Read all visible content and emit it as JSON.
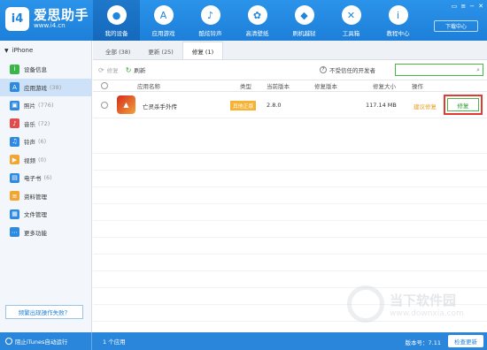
{
  "brand": {
    "name": "爱思助手",
    "url": "www.i4.cn",
    "badge": "i4"
  },
  "nav": [
    {
      "label": "我的设备",
      "icon": "apple-icon",
      "glyph": "",
      "active": true
    },
    {
      "label": "应用游戏",
      "icon": "app-store-icon",
      "glyph": "A"
    },
    {
      "label": "酷炫铃声",
      "icon": "bell-icon",
      "glyph": "♪"
    },
    {
      "label": "高清壁纸",
      "icon": "wallpaper-icon",
      "glyph": "✿"
    },
    {
      "label": "刷机越狱",
      "icon": "box-icon",
      "glyph": "◆"
    },
    {
      "label": "工具箱",
      "icon": "tools-icon",
      "glyph": "✕"
    },
    {
      "label": "教程中心",
      "icon": "info-icon",
      "glyph": "i"
    }
  ],
  "download_center": "下载中心",
  "sidebar": {
    "device": "iPhone",
    "items": [
      {
        "label": "设备信息",
        "count": "",
        "icon": "device-info-icon",
        "color": "#3bb54a"
      },
      {
        "label": "应用游戏",
        "count": "(38)",
        "icon": "apps-icon",
        "color": "#2d8ae0"
      },
      {
        "label": "照片",
        "count": "(776)",
        "icon": "photos-icon",
        "color": "#2d8ae0"
      },
      {
        "label": "音乐",
        "count": "(72)",
        "icon": "music-icon",
        "color": "#e24b4b"
      },
      {
        "label": "铃声",
        "count": "(6)",
        "icon": "ringtone-icon",
        "color": "#2d8ae0"
      },
      {
        "label": "视频",
        "count": "(0)",
        "icon": "video-icon",
        "color": "#f2a531"
      },
      {
        "label": "电子书",
        "count": "(6)",
        "icon": "ebook-icon",
        "color": "#2d8ae0"
      },
      {
        "label": "资料管理",
        "count": "",
        "icon": "data-manage-icon",
        "color": "#f2a531"
      },
      {
        "label": "文件管理",
        "count": "",
        "icon": "file-manage-icon",
        "color": "#2d8ae0"
      },
      {
        "label": "更多功能",
        "count": "",
        "icon": "more-icon",
        "color": "#2d8ae0"
      }
    ],
    "feedback": "频繁出现操作失败？"
  },
  "tabs": [
    {
      "label": "全部 (38)"
    },
    {
      "label": "更新 (25)"
    },
    {
      "label": "修复 (1)",
      "active": true
    }
  ],
  "toolbar": {
    "repair": "修复",
    "refresh": "刷新",
    "untrusted": "不受信任的开发者"
  },
  "table": {
    "headers": {
      "name": "应用名称",
      "type": "类型",
      "current": "当前版本",
      "repair_ver": "修复版本",
      "size": "修复大小",
      "action": "操作"
    },
    "rows": [
      {
        "name": "亡灵杀手外传",
        "type": "其他正版",
        "current": "2.8.0",
        "repair_ver": "",
        "size": "117.14 MB",
        "suggest": "建议修复",
        "button": "修复"
      }
    ]
  },
  "watermark": {
    "title": "当下软件园",
    "sub": "www.downxia.com"
  },
  "status": {
    "itunes": "阻止iTunes自动运行",
    "count": "1 个应用",
    "version": "版本号：7.11",
    "update": "检查更新"
  }
}
